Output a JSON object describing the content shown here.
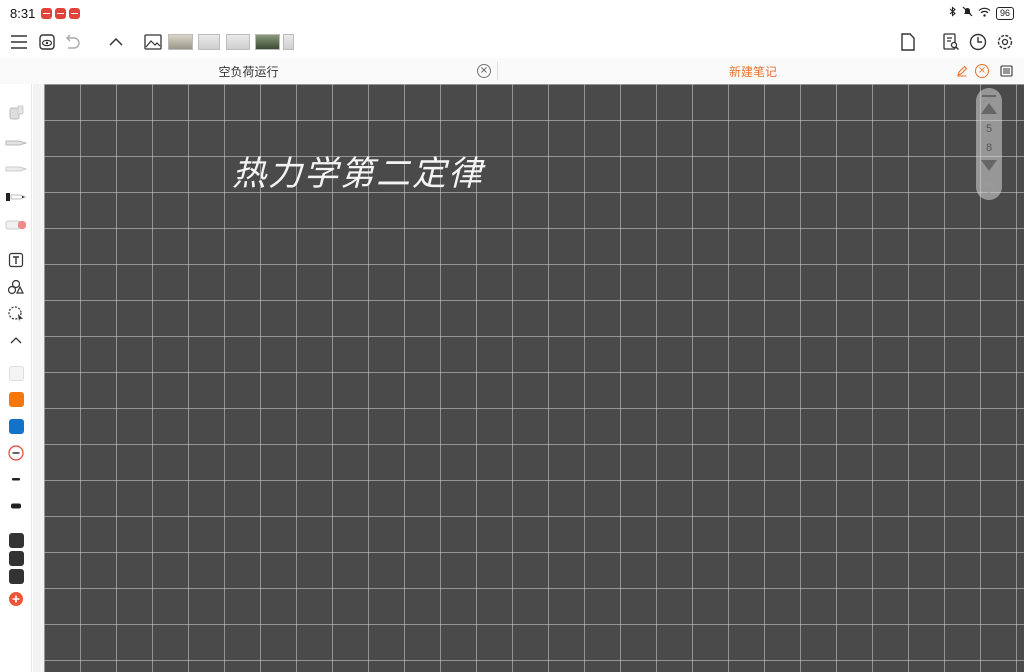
{
  "status_bar": {
    "time": "8:31",
    "battery": "96"
  },
  "toolbar": {
    "icons": [
      "menu-icon",
      "eye-icon",
      "undo-icon",
      "chevron-up-icon",
      "image-icon",
      "new-page-icon",
      "search-doc-icon",
      "history-icon",
      "settings-icon"
    ]
  },
  "tabs": {
    "left": {
      "label": "空负荷运行"
    },
    "right": {
      "label": "新建笔记"
    }
  },
  "canvas": {
    "handwritten_text": "热力学第二定律",
    "background": "#4a4a4a",
    "grid_color": "#d2d2d2"
  },
  "page_nav": {
    "current": "5",
    "total": "8"
  },
  "palette": {
    "orange": "#f5780f",
    "blue": "#1472c9",
    "dark": "#333333",
    "add_color": "#ee5537"
  }
}
